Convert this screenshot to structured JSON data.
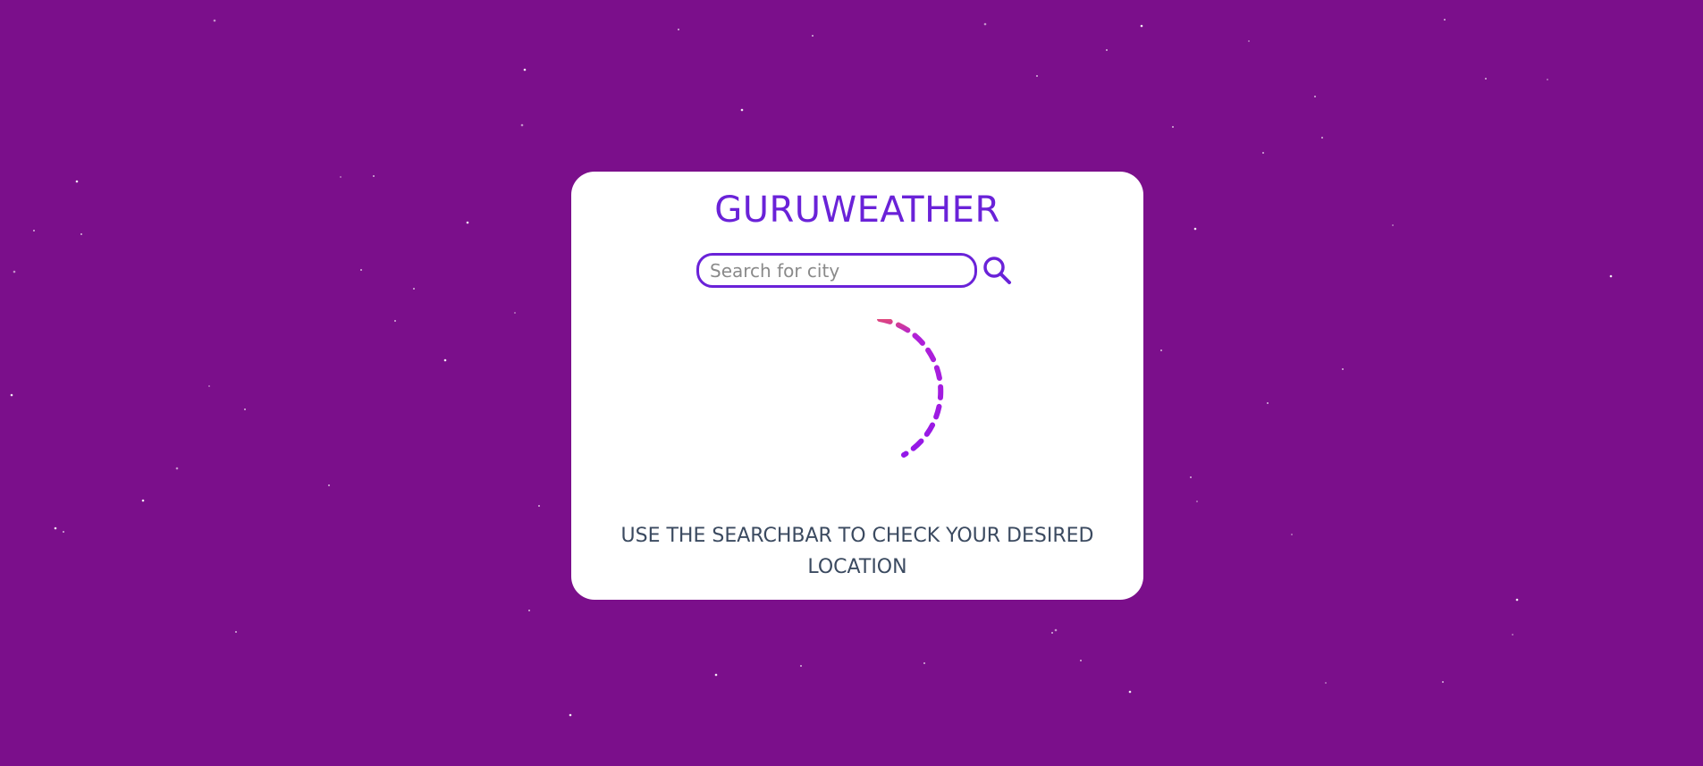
{
  "app": {
    "title": "GURUWEATHER"
  },
  "search": {
    "placeholder": "Search for city",
    "value": "",
    "button_icon": "search-icon"
  },
  "status": {
    "loading_icon": "loading-spinner-icon",
    "message": "USE THE SEARCHBAR TO CHECK YOUR DESIRED LOCATION"
  },
  "colors": {
    "background": "#7b0f8b",
    "card": "#ffffff",
    "accent": "#6a22d8",
    "spinner_primary": "#9418e8",
    "spinner_tail": "#e0487a",
    "message_text": "#3b4a60"
  }
}
